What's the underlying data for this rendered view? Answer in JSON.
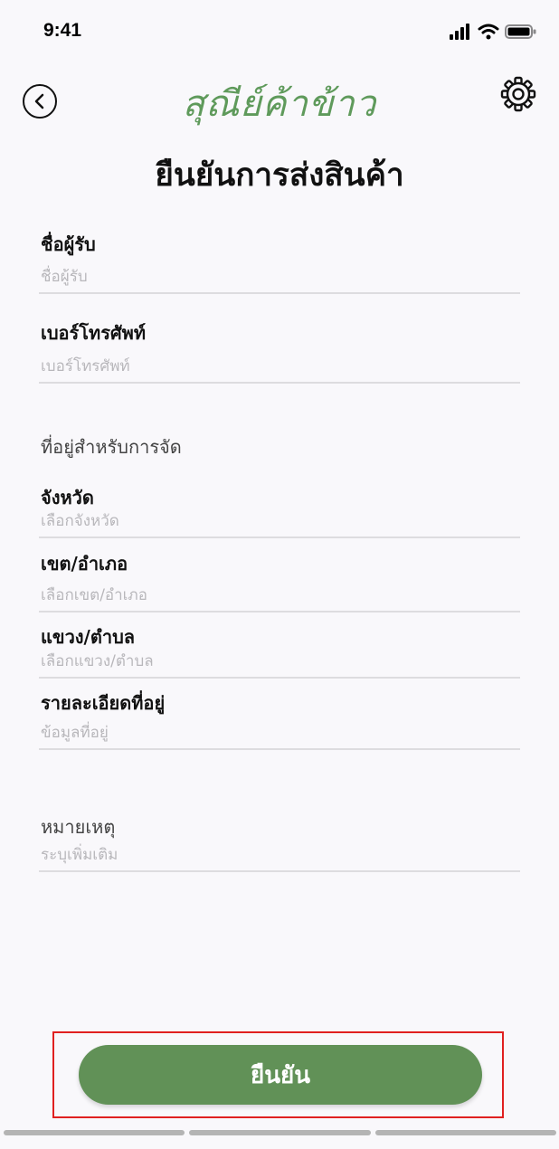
{
  "status_bar": {
    "time": "9:41"
  },
  "header": {
    "app_name": "สุณีย์ค้าข้าว",
    "page_title": "ยืนยันการส่งสินค้า"
  },
  "form": {
    "recipient_name": {
      "label": "ชื่อผู้รับ",
      "placeholder": "ชื่อผู้รับ"
    },
    "phone": {
      "label": "เบอร์โทรศัพท์",
      "placeholder": "เบอร์โทรศัพท์"
    },
    "shipping_address_heading": "ที่อยู่สำหรับการจัด",
    "province": {
      "label": "จังหวัด",
      "placeholder": "เลือกจังหวัด"
    },
    "district": {
      "label": "เขต/อำเภอ",
      "placeholder": "เลือกเขต/อำเภอ"
    },
    "subdistrict": {
      "label": "แขวง/ตำบล",
      "placeholder": "เลือกแขวง/ตำบล"
    },
    "address_detail": {
      "label": "รายละเอียดที่อยู่",
      "placeholder": "ข้อมูลที่อยู่"
    },
    "note": {
      "label": "หมายเหตุ",
      "placeholder": "ระบุเพิ่มเติม"
    }
  },
  "confirm_button": {
    "label": "ยืนยัน"
  },
  "colors": {
    "brand_green": "#5f9a5b",
    "button_green": "#619157",
    "highlight_red": "#e02020"
  }
}
